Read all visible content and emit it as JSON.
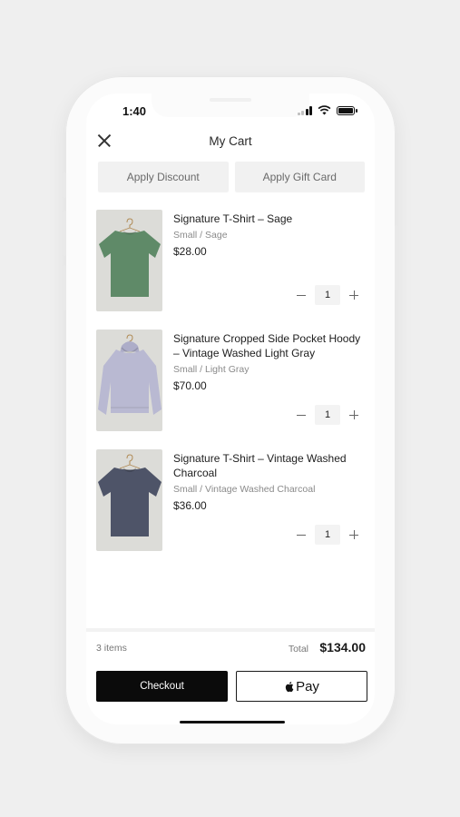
{
  "status_bar": {
    "time": "1:40"
  },
  "header": {
    "title": "My Cart"
  },
  "actions": {
    "discount_label": "Apply Discount",
    "gift_card_label": "Apply Gift Card"
  },
  "cart": {
    "items": [
      {
        "name": "Signature T-Shirt – Sage",
        "variant": "Small / Sage",
        "price": "$28.00",
        "quantity": "1",
        "color": "#5f8a68"
      },
      {
        "name": "Signature Cropped Side Pocket Hoody – Vintage Washed Light Gray",
        "variant": "Small / Light Gray",
        "price": "$70.00",
        "quantity": "1",
        "color": "#b9b9d2"
      },
      {
        "name": "Signature T-Shirt – Vintage Washed Charcoal",
        "variant": "Small / Vintage Washed Charcoal",
        "price": "$36.00",
        "quantity": "1",
        "color": "#4e5468"
      }
    ]
  },
  "summary": {
    "item_count": "3 items",
    "total_label": "Total",
    "total_value": "$134.00"
  },
  "checkout": {
    "checkout_label": "Checkout",
    "apple_pay_label": "Pay"
  }
}
